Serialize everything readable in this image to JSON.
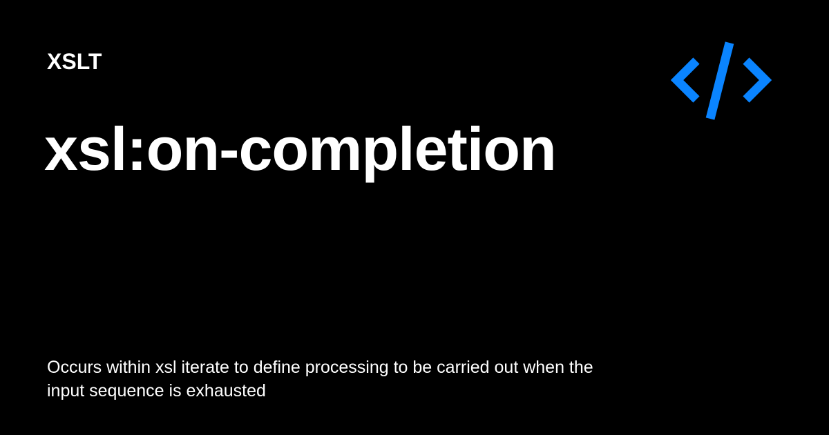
{
  "card": {
    "category": "XSLT",
    "title": "xsl:on-completion",
    "description": "Occurs within xsl iterate to define processing to be carried out when the input sequence is exhausted"
  },
  "logo": {
    "icon": "code-brackets-icon",
    "color": "#0A84FF"
  },
  "colors": {
    "background": "#000000",
    "text": "#FFFFFF",
    "accent": "#0A84FF"
  }
}
